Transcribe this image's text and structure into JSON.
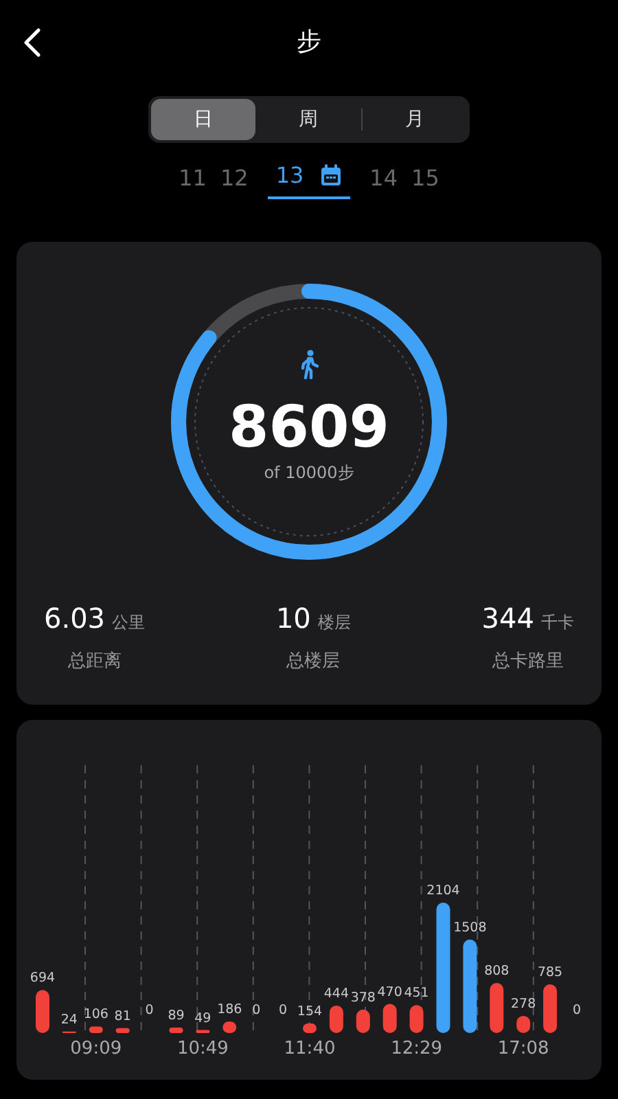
{
  "header": {
    "title": "步"
  },
  "period_tabs": [
    {
      "label": "日",
      "selected": true
    },
    {
      "label": "周",
      "selected": false
    },
    {
      "label": "月",
      "selected": false
    }
  ],
  "dates": [
    {
      "label": "11",
      "selected": false
    },
    {
      "label": "12",
      "selected": false
    },
    {
      "label": "13",
      "selected": true
    },
    {
      "label": "14",
      "selected": false
    },
    {
      "label": "15",
      "selected": false
    }
  ],
  "ring": {
    "level": 0.8609,
    "value": "8609",
    "goal": "of 10000步"
  },
  "stats": [
    {
      "value": "6.03",
      "unit": "公里",
      "label": "总距离"
    },
    {
      "value": "10",
      "unit": "楼层",
      "label": "总楼层"
    },
    {
      "value": "344",
      "unit": "千卡",
      "label": "总卡路里"
    }
  ],
  "activity": {
    "chart_data": {
      "type": "bar",
      "data_labels": true,
      "grid": true,
      "categories": [
        null,
        null,
        "09:09",
        null,
        null,
        null,
        "10:49",
        null,
        null,
        null,
        "11:40",
        null,
        null,
        null,
        "12:29",
        null,
        null,
        null,
        "17:08",
        null,
        null
      ],
      "series": [
        {
          "color": "#f2413a",
          "values": [
            694,
            24,
            106,
            81,
            0,
            89,
            49,
            186,
            0,
            0,
            154,
            444,
            378,
            470,
            451,
            2104,
            1508,
            808,
            278,
            785,
            0
          ],
          "colors": [
            null,
            null,
            null,
            null,
            null,
            null,
            null,
            null,
            null,
            null,
            null,
            null,
            null,
            null,
            null,
            "#3fa2f7",
            "#3fa2f7",
            null,
            null,
            null,
            null
          ]
        }
      ]
    }
  }
}
